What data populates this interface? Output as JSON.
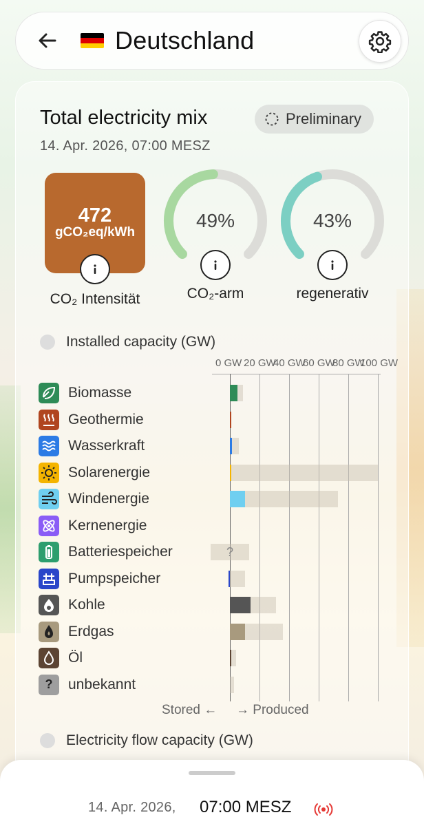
{
  "header": {
    "title": "Deutschland",
    "flag_colors": [
      "#000000",
      "#DD0000",
      "#FFCE00"
    ]
  },
  "card": {
    "title": "Total electricity mix",
    "badge": "Preliminary",
    "date": "14. Apr. 2026, 07:00 MESZ"
  },
  "metrics": {
    "co2_value": "472",
    "co2_unit": "gCO₂eq/kWh",
    "co2_label": "CO₂ Intensität",
    "co2_color": "#b8692e",
    "low_carbon_value": "49%",
    "low_carbon_fraction": 0.49,
    "low_carbon_label": "CO₂-arm",
    "low_carbon_color": "#a8d8a0",
    "renewable_value": "43%",
    "renewable_fraction": 0.43,
    "renewable_label": "regenerativ",
    "renewable_color": "#7ccfc3"
  },
  "installed": {
    "header": "Installed capacity (GW)",
    "ticks": [
      "0 GW",
      "20 GW",
      "40 GW",
      "60 GW",
      "80 GW",
      "100 GW"
    ],
    "stored_label": "Stored ←",
    "produced_label": "→ Produced",
    "unknown_marker": "?",
    "sources": [
      {
        "label": "Biomasse",
        "icon": "leaf-icon",
        "color": "#2e8b57",
        "produced_gw": 5,
        "capacity_gw": 9
      },
      {
        "label": "Geothermie",
        "icon": "heat-icon",
        "color": "#b0451f",
        "produced_gw": 0.2,
        "capacity_gw": 0.5
      },
      {
        "label": "Wasserkraft",
        "icon": "water-icon",
        "color": "#2c7be5",
        "produced_gw": 1.5,
        "capacity_gw": 6
      },
      {
        "label": "Solarenergie",
        "icon": "sun-icon",
        "color": "#f4b400",
        "produced_gw": 1,
        "capacity_gw": 100
      },
      {
        "label": "Windenergie",
        "icon": "wind-icon",
        "color": "#6fcff0",
        "produced_gw": 10,
        "capacity_gw": 73
      },
      {
        "label": "Kernenergie",
        "icon": "atom-icon",
        "color": "#8a5cf6",
        "produced_gw": 0,
        "capacity_gw": 0
      },
      {
        "label": "Batteriespeicher",
        "icon": "battery-icon",
        "color": "#2e9e6e",
        "produced_gw": 0,
        "capacity_gw": 0
      },
      {
        "label": "Pumpspeicher",
        "icon": "pump-icon",
        "color": "#2a46c9",
        "produced_gw": 0,
        "capacity_gw": 10,
        "stored_gw": 1
      },
      {
        "label": "Kohle",
        "icon": "coal-icon",
        "color": "#555555",
        "produced_gw": 14,
        "capacity_gw": 31
      },
      {
        "label": "Erdgas",
        "icon": "gas-icon",
        "color": "#a89a7e",
        "produced_gw": 10,
        "capacity_gw": 36
      },
      {
        "label": "Öl",
        "icon": "oil-icon",
        "color": "#5c4433",
        "produced_gw": 1,
        "capacity_gw": 4
      },
      {
        "label": "unbekannt",
        "icon": "question-icon",
        "color": "#9e9e9e",
        "produced_gw": 0,
        "capacity_gw": 3
      }
    ]
  },
  "flow": {
    "header": "Electricity flow capacity (GW)"
  },
  "sheet": {
    "date": "14. Apr. 2026,",
    "time": "07:00 MESZ"
  }
}
